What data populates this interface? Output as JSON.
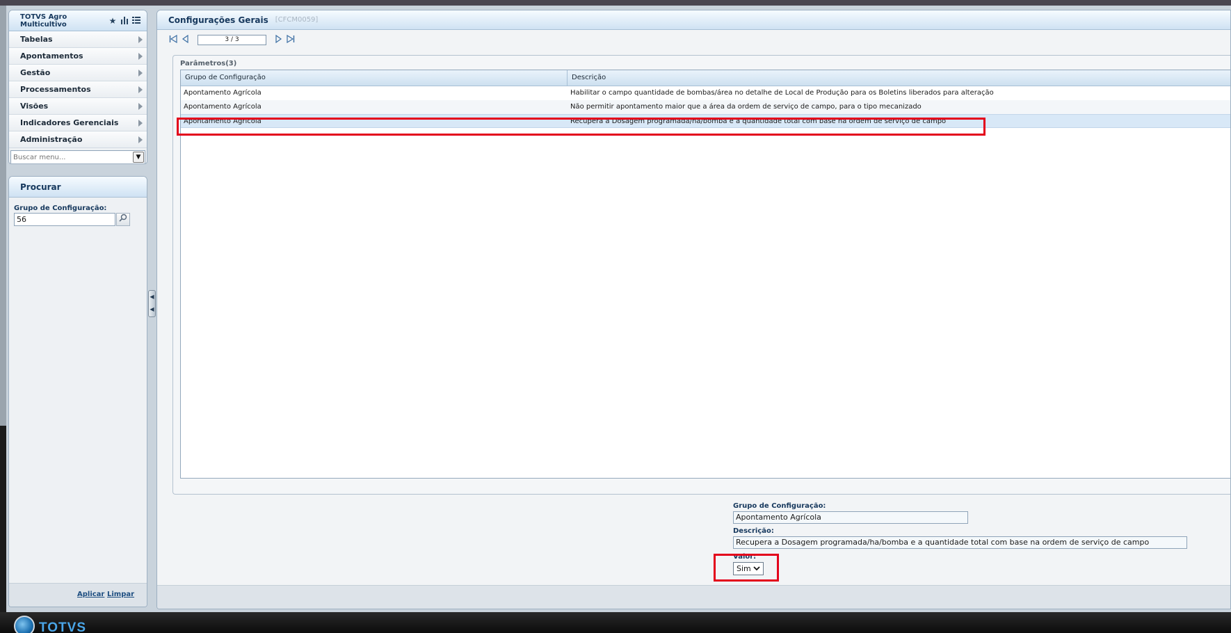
{
  "app": {
    "title": "TOTVS Agro Multicultivo",
    "logo_text": "TOTVS"
  },
  "menu": {
    "items": [
      {
        "label": "Tabelas"
      },
      {
        "label": "Apontamentos"
      },
      {
        "label": "Gestão"
      },
      {
        "label": "Processamentos"
      },
      {
        "label": "Visões"
      },
      {
        "label": "Indicadores Gerenciais"
      },
      {
        "label": "Administração"
      }
    ],
    "search_placeholder": "Buscar menu...",
    "header_icons": [
      "star-icon",
      "bar-chart-icon",
      "list-icon"
    ]
  },
  "search": {
    "title": "Procurar",
    "field_label": "Grupo de Configuração:",
    "field_value": "56",
    "apply_label": "Aplicar",
    "clear_label": "Limpar"
  },
  "main": {
    "title": "Configurações Gerais",
    "code": "[CFCM0059]",
    "pagination": "3 / 3"
  },
  "params": {
    "title": "Parâmetros(3)",
    "columns": [
      "Grupo de Configuração",
      "Descrição"
    ],
    "rows": [
      {
        "grupo": "Apontamento Agrícola",
        "descricao": "Habilitar o campo quantidade de bombas/área no detalhe de Local de Produção para os Boletins liberados para alteração"
      },
      {
        "grupo": "Apontamento Agrícola",
        "descricao": "Não permitir apontamento maior que a área da ordem de serviço de campo, para o tipo mecanizado"
      },
      {
        "grupo": "Apontamento Agrícola",
        "descricao": "Recupera a Dosagem programada/ha/bomba e a quantidade total com base na ordem de serviço de campo"
      }
    ],
    "selected_row": 3
  },
  "detail": {
    "grupo_label": "Grupo de Configuração:",
    "grupo_value": "Apontamento Agrícola",
    "descricao_label": "Descrição:",
    "descricao_value": "Recupera a Dosagem programada/ha/bomba e a quantidade total com base na ordem de serviço de campo",
    "valor_label": "Valor:",
    "valor_value": "Sim"
  },
  "colors": {
    "highlight": "#e3001b",
    "header_text": "#16385d",
    "selected_row": "#d8e8f7"
  }
}
